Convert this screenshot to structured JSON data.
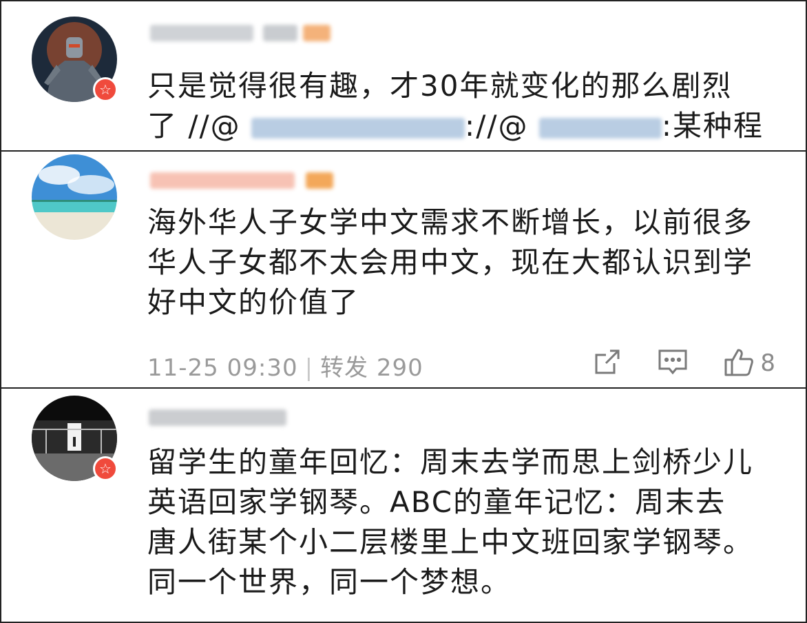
{
  "comments": [
    {
      "text_lines": [
        "只是觉得很有趣，才30年就变化的那么剧烈",
        "了"
      ],
      "repost_chain": {
        "mention_1_prefix": "//@",
        "mention_1_sep": ":",
        "mention_2_prefix": "//@",
        "mention_2_suffix": ":某种程度"
      }
    },
    {
      "text_lines": [
        "海外华人子女学中文需求不断增长，以前很多",
        "华人子女都不太会用中文，现在大都认识到学",
        "好中文的价值了"
      ],
      "meta": {
        "timestamp": "11-25 09:30",
        "separator": "|",
        "repost_label": "转发 290"
      },
      "actions": {
        "share_icon": "share-icon",
        "comment_icon": "comment-icon",
        "like_icon": "thumbs-up-icon",
        "like_count": "8"
      }
    },
    {
      "text_lines": [
        "留学生的童年回忆：周末去学而思上剑桥少儿",
        "英语回家学钢琴。ABC的童年记忆：周末去",
        "唐人街某个小二层楼里上中文班回家学钢琴。",
        "同一个世界，同一个梦想。"
      ]
    }
  ],
  "colors": {
    "mention": "#4f7ebf",
    "badge": "#f04a3c",
    "meta_text": "#9a9a9a"
  }
}
